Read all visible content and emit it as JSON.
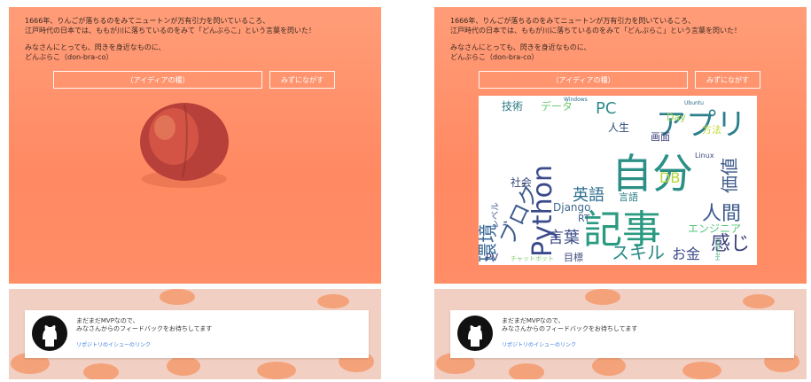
{
  "intro": {
    "line1": "1666年、りんごが落ちるのをみてニュートンが万有引力を閃いているころ、",
    "line2": "江戸時代の日本では、ももが川に落ちているのをみて「どんぶらこ」という言葉を閃いた！",
    "line3": "みなさんにとっても、閃きを身近なものに、",
    "line4": "どんぶらこ（don-bra-co）"
  },
  "input": {
    "placeholder": "（アイディアの種）"
  },
  "button": {
    "label": "みずにながす"
  },
  "footer": {
    "line1": "まだまだMVPなので、",
    "line2": "みなさんからのフィードバックをお待ちしてます",
    "link": "リポジトリのイシューのリンク"
  },
  "wordcloud": [
    {
      "t": "自分",
      "c": "#2c8f86"
    },
    {
      "t": "記事",
      "c": "#2a9a80"
    },
    {
      "t": "Python",
      "c": "#3a4a8a"
    },
    {
      "t": "アプリ",
      "c": "#2c7f8c"
    },
    {
      "t": "ブログ",
      "c": "#3e5b8c"
    },
    {
      "t": "環境",
      "c": "#3c6c9a"
    },
    {
      "t": "言葉",
      "c": "#3c4c8a"
    },
    {
      "t": "スキル",
      "c": "#2a8a86"
    },
    {
      "t": "人間",
      "c": "#3b5a8d"
    },
    {
      "t": "感じ",
      "c": "#3b3f7a"
    },
    {
      "t": "英語",
      "c": "#2c6e8e"
    },
    {
      "t": "お金",
      "c": "#3c4a8a"
    },
    {
      "t": "エンジニア",
      "c": "#59c47a"
    },
    {
      "t": "価値",
      "c": "#3d5a8a"
    },
    {
      "t": "PC",
      "c": "#2e8b8a"
    },
    {
      "t": "Django",
      "c": "#3f6a8f"
    },
    {
      "t": "技術",
      "c": "#2c7a86"
    },
    {
      "t": "人生",
      "c": "#2a4a7a"
    },
    {
      "t": "データ",
      "c": "#6fca6e"
    },
    {
      "t": "DB",
      "c": "#b5d63a"
    },
    {
      "t": "Day",
      "c": "#9ad24c"
    },
    {
      "t": "画面",
      "c": "#3a3f7a"
    },
    {
      "t": "方法",
      "c": "#c0d836"
    },
    {
      "t": "目標",
      "c": "#3f4c7e"
    },
    {
      "t": "言語",
      "c": "#2a7e86"
    },
    {
      "t": "社会",
      "c": "#3a4a7a"
    },
    {
      "t": "RT",
      "c": "#3f5e8e"
    },
    {
      "t": "PV",
      "c": "#3a3f7a"
    },
    {
      "t": "レベル",
      "c": "#4a5e9a"
    },
    {
      "t": "Linux",
      "c": "#3a4a7a"
    },
    {
      "t": "Heroku",
      "c": "#5ab98a"
    },
    {
      "t": "Windows",
      "c": "#2a6c8a"
    },
    {
      "t": "Ubuntu",
      "c": "#2a6c8a"
    },
    {
      "t": "チャットボット",
      "c": "#7ecb6a"
    }
  ]
}
